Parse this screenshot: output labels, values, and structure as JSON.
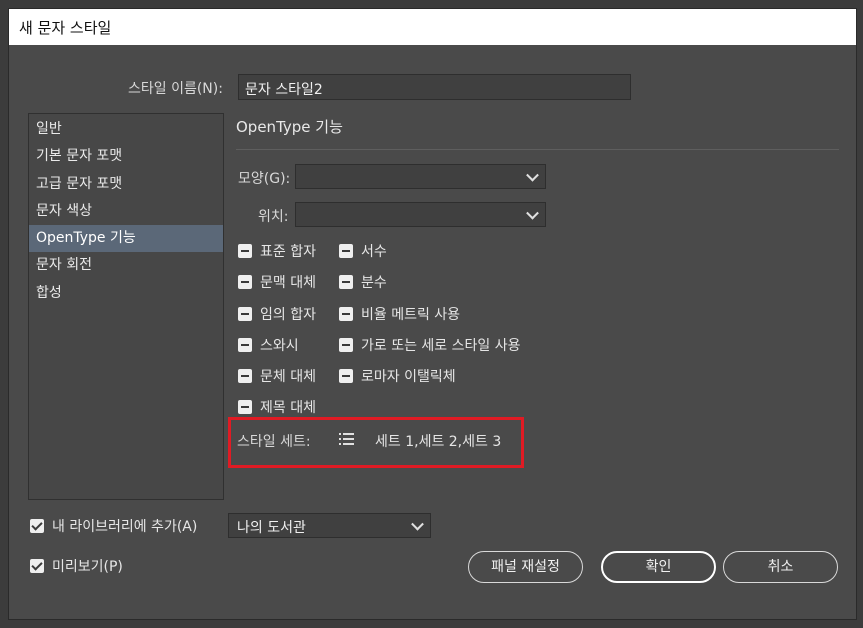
{
  "window": {
    "title": "새 문자 스타일"
  },
  "style_name": {
    "label": "스타일 이름(N):",
    "value": "문자 스타일2"
  },
  "sidebar": {
    "items": [
      {
        "label": "일반"
      },
      {
        "label": "기본 문자 포맷"
      },
      {
        "label": "고급 문자 포맷"
      },
      {
        "label": "문자 색상"
      },
      {
        "label": "OpenType 기능"
      },
      {
        "label": "문자 회전"
      },
      {
        "label": "합성"
      }
    ],
    "active_index": 4
  },
  "panel": {
    "title": "OpenType 기능",
    "shape_label": "모양(G):",
    "shape_value": "",
    "position_label": "위치:",
    "position_value": "",
    "checkboxes_left": [
      "표준 합자",
      "문맥 대체",
      "임의 합자",
      "스와시",
      "문체 대체",
      "제목 대체"
    ],
    "checkboxes_right": [
      "서수",
      "분수",
      "비율 메트릭 사용",
      "가로 또는 세로 스타일 사용",
      "로마자 이탤릭체"
    ],
    "style_sets_label": "스타일 세트:",
    "style_sets_value": "세트 1,세트 2,세트 3",
    "style_sets_icon": "list-icon"
  },
  "footer": {
    "add_library_label": "내 라이브러리에 추가(A)",
    "add_library_checked": true,
    "library_value": "나의 도서관",
    "preview_label": "미리보기(P)",
    "preview_checked": true,
    "reset_button": "패널 재설정",
    "ok_button": "확인",
    "cancel_button": "취소"
  },
  "colors": {
    "accent_active": "#5b6878",
    "highlight": "#e01b24"
  }
}
